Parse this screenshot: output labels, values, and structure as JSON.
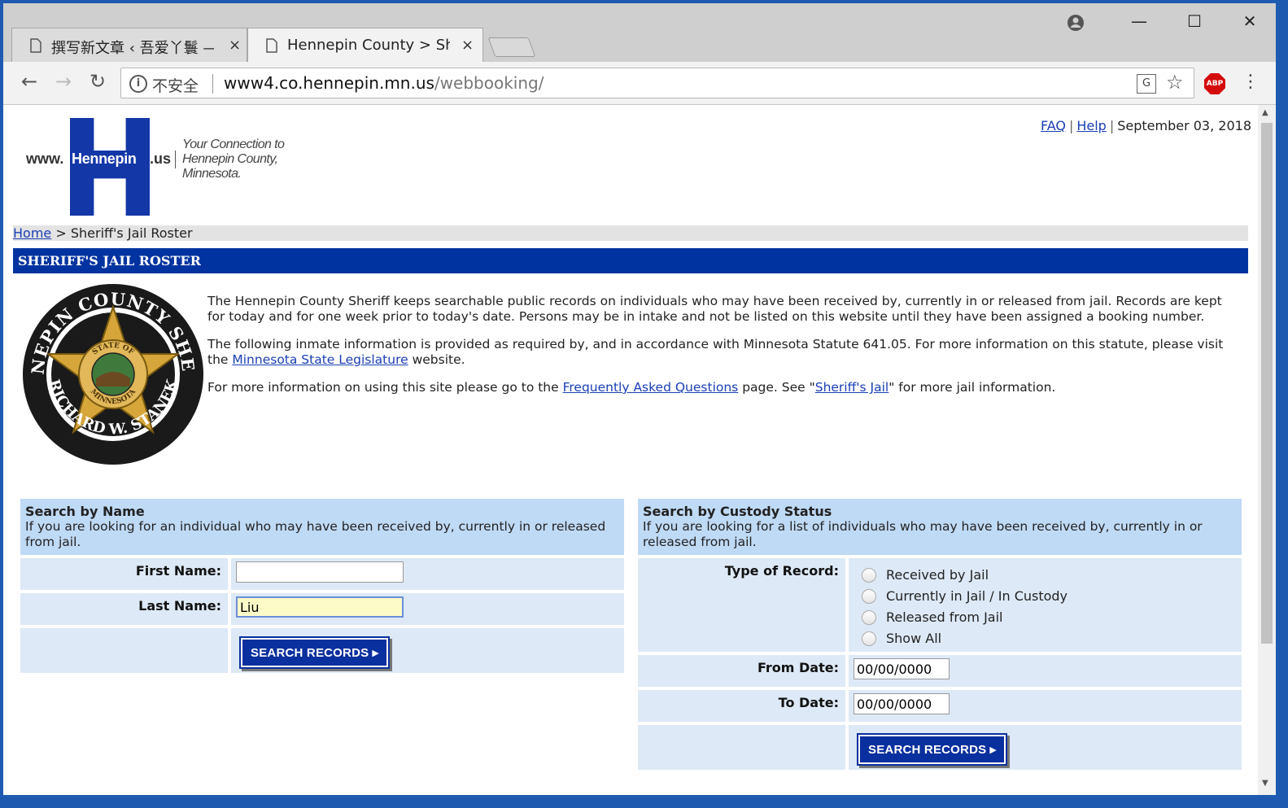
{
  "browser": {
    "tabs": [
      {
        "label": "撰写新文章 ‹ 吾爱丫鬟 —",
        "close": "×"
      },
      {
        "label": "Hennepin County > She",
        "close": "×"
      }
    ],
    "window_controls": {
      "minimize": "—",
      "maximize": "☐",
      "close": "✕"
    },
    "nav": {
      "back": "←",
      "forward": "→",
      "reload": "↻"
    },
    "omnibox": {
      "security_label": "不安全",
      "url_host": "www4.co.hennepin.mn.us",
      "url_path": "/webbooking/"
    },
    "extensions": {
      "abp": "ABP",
      "menu": "⋮"
    }
  },
  "header": {
    "logo": {
      "www": "www.",
      "hennepin": "Hennepin",
      "us": ".us",
      "tagline": "Your Connection to Hennepin County, Minnesota."
    },
    "links": {
      "faq": "FAQ",
      "help": "Help",
      "sep": "|",
      "date": "September 03, 2018"
    }
  },
  "breadcrumb": {
    "home": "Home",
    "separator": ">",
    "current": "Sheriff's Jail Roster"
  },
  "page_title": "SHERIFF'S JAIL ROSTER",
  "seal": {
    "top_text": "HENNEPIN COUNTY SHERIFF",
    "bottom_text": "RICHARD W. STANEK",
    "center_top": "STATE OF",
    "center_bottom": "MINNESOTA"
  },
  "intro": {
    "p1": "The Hennepin County Sheriff keeps searchable public records on individuals who may have been received by, currently in or released from jail. Records are kept for today and for one week prior to today's date. Persons may be in intake and not be listed on this website until they have been assigned a booking number.",
    "p2_before": "The following inmate information is provided as required by, and in accordance with Minnesota Statute 641.05. For more information on this statute, please visit the ",
    "p2_link": "Minnesota State Legislature",
    "p2_after": " website.",
    "p3_before": "For more information on using this site please go to the ",
    "p3_link1": "Frequently Asked Questions",
    "p3_mid": " page. See \"",
    "p3_link2": "Sheriff's Jail",
    "p3_after": "\" for more jail information."
  },
  "search_by_name": {
    "title": "Search by Name",
    "description": "If you are looking for an individual who may have been received by, currently in or released from jail.",
    "first_name_label": "First Name:",
    "first_name_value": "",
    "last_name_label": "Last Name:",
    "last_name_value": "Liu",
    "button": "SEARCH RECORDS ▸"
  },
  "search_by_custody": {
    "title": "Search by Custody Status",
    "description": "If you are looking for a list of individuals who may have been received by, currently in or released from jail.",
    "type_label": "Type of Record:",
    "options": [
      "Received by Jail",
      "Currently in Jail / In Custody",
      "Released from Jail",
      "Show All"
    ],
    "from_label": "From Date:",
    "from_value": "00/00/0000",
    "to_label": "To Date:",
    "to_value": "00/00/0000",
    "button": "SEARCH RECORDS ▸"
  },
  "colors": {
    "title_bar": "#0033a0",
    "panel_header": "#bfdaf5",
    "panel_cell": "#dde9f6",
    "link": "#1a3fb4",
    "logo_blue": "#1437a8"
  }
}
